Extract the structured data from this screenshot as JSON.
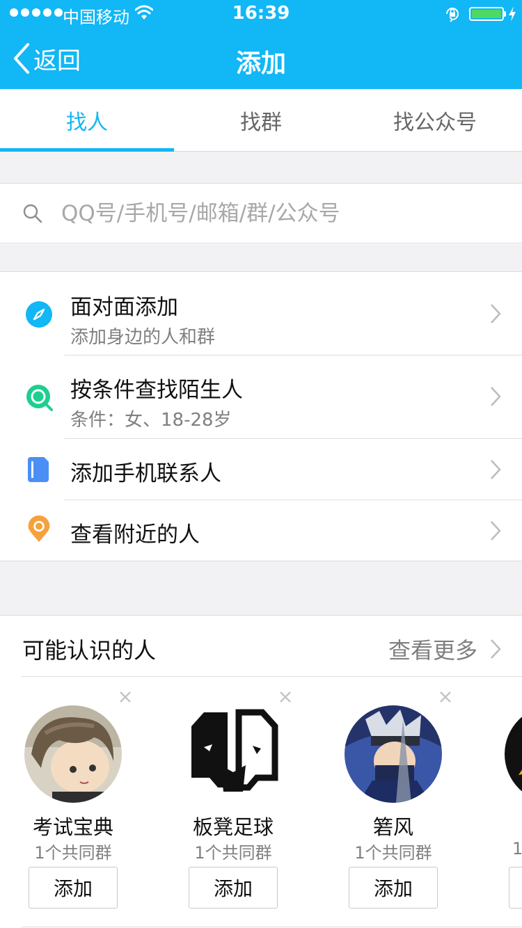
{
  "status_bar": {
    "carrier": "中国移动",
    "time": "16:39",
    "icons": [
      "signal-dots-icon",
      "wifi-icon",
      "rotation-lock-icon",
      "battery-icon",
      "charging-bolt-icon"
    ]
  },
  "nav": {
    "back_label": "返回",
    "title": "添加"
  },
  "tabs": [
    {
      "label": "找人",
      "active": true
    },
    {
      "label": "找群",
      "active": false
    },
    {
      "label": "找公众号",
      "active": false
    }
  ],
  "search": {
    "placeholder": "QQ号/手机号/邮箱/群/公众号",
    "value": ""
  },
  "menu": [
    {
      "title": "面对面添加",
      "subtitle": "添加身边的人和群",
      "icon": "compass-icon",
      "color": "#12b7f5"
    },
    {
      "title": "按条件查找陌生人",
      "subtitle": "条件：女、18-28岁",
      "icon": "magnifier-icon",
      "color": "#1dcf8f"
    },
    {
      "title": "添加手机联系人",
      "subtitle": "",
      "icon": "contacts-book-icon",
      "color": "#4b8ef5"
    },
    {
      "title": "查看附近的人",
      "subtitle": "",
      "icon": "location-pin-icon",
      "color": "#f6a13c"
    }
  ],
  "people_section": {
    "title": "可能认识的人",
    "see_more": "查看更多",
    "cards": [
      {
        "name": "考试宝典",
        "mutual": "1个共同群",
        "add_label": "添加",
        "avatar": "anime-boy-avatar"
      },
      {
        "name": "板凳足球",
        "mutual": "1个共同群",
        "add_label": "添加",
        "avatar": "mask-logo-avatar"
      },
      {
        "name": "箬风",
        "mutual": "1个共同群",
        "add_label": "添加",
        "avatar": "ninja-avatar"
      },
      {
        "name": "",
        "mutual": "1",
        "add_label": "",
        "avatar": "partial-avatar"
      }
    ]
  },
  "colors": {
    "accent": "#12b7f5",
    "battery": "#4cd964",
    "section_bg": "#f2f2f4"
  }
}
